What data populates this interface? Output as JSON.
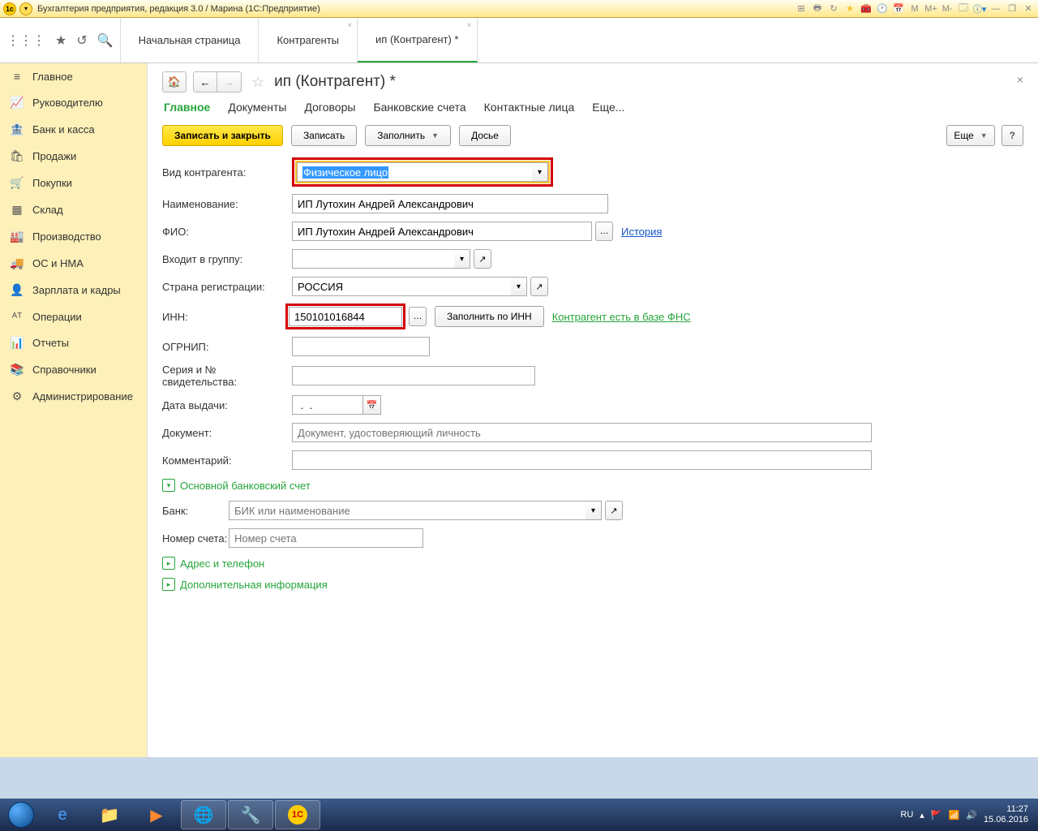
{
  "titlebar": {
    "text": "Бухгалтерия предприятия, редакция 3.0 / Марина  (1С:Предприятие)"
  },
  "tabs": {
    "t1": "Начальная страница",
    "t2": "Контрагенты",
    "t3": "ип (Контрагент) *"
  },
  "sidebar": [
    {
      "icon": "≡",
      "label": "Главное"
    },
    {
      "icon": "📈",
      "label": "Руководителю"
    },
    {
      "icon": "🏦",
      "label": "Банк и касса"
    },
    {
      "icon": "🛍",
      "label": "Продажи"
    },
    {
      "icon": "🛒",
      "label": "Покупки"
    },
    {
      "icon": "▦",
      "label": "Склад"
    },
    {
      "icon": "🏭",
      "label": "Производство"
    },
    {
      "icon": "🚚",
      "label": "ОС и НМА"
    },
    {
      "icon": "👤",
      "label": "Зарплата и кадры"
    },
    {
      "icon": "ᴬᵀ",
      "label": "Операции"
    },
    {
      "icon": "📊",
      "label": "Отчеты"
    },
    {
      "icon": "📚",
      "label": "Справочники"
    },
    {
      "icon": "⚙",
      "label": "Администрирование"
    }
  ],
  "page": {
    "title": "ип (Контрагент) *"
  },
  "subtabs": {
    "main": "Главное",
    "docs": "Документы",
    "contracts": "Договоры",
    "bank": "Банковские счета",
    "contacts": "Контактные лица",
    "more": "Еще..."
  },
  "actions": {
    "save_close": "Записать и закрыть",
    "save": "Записать",
    "fill": "Заполнить",
    "dossier": "Досье",
    "more": "Еще",
    "help": "?"
  },
  "form": {
    "kind_label": "Вид контрагента:",
    "kind_value": "Физическое лицо",
    "name_label": "Наименование:",
    "name_value": "ИП Лутохин Андрей Александрович",
    "fio_label": "ФИО:",
    "fio_value": "ИП Лутохин Андрей Александрович",
    "history": "История",
    "group_label": "Входит в группу:",
    "country_label": "Страна регистрации:",
    "country_value": "РОССИЯ",
    "inn_label": "ИНН:",
    "inn_value": "150101016844",
    "fill_by_inn": "Заполнить по ИНН",
    "inn_status": "Контрагент есть в базе ФНС",
    "ogrnip_label": "ОГРНИП:",
    "cert_label": "Серия и № свидетельства:",
    "issue_date_label": "Дата выдачи:",
    "issue_date_value": " .  .    ",
    "document_label": "Документ:",
    "document_placeholder": "Документ, удостоверяющий личность",
    "comment_label": "Комментарий:"
  },
  "bank_section": {
    "title": "Основной банковский счет",
    "bank_label": "Банк:",
    "bank_placeholder": "БИК или наименование",
    "account_label": "Номер счета:",
    "account_placeholder": "Номер счета"
  },
  "sections": {
    "address": "Адрес и телефон",
    "extra": "Дополнительная информация"
  },
  "tray": {
    "lang": "RU",
    "time": "11:27",
    "date": "15.06.2016"
  }
}
